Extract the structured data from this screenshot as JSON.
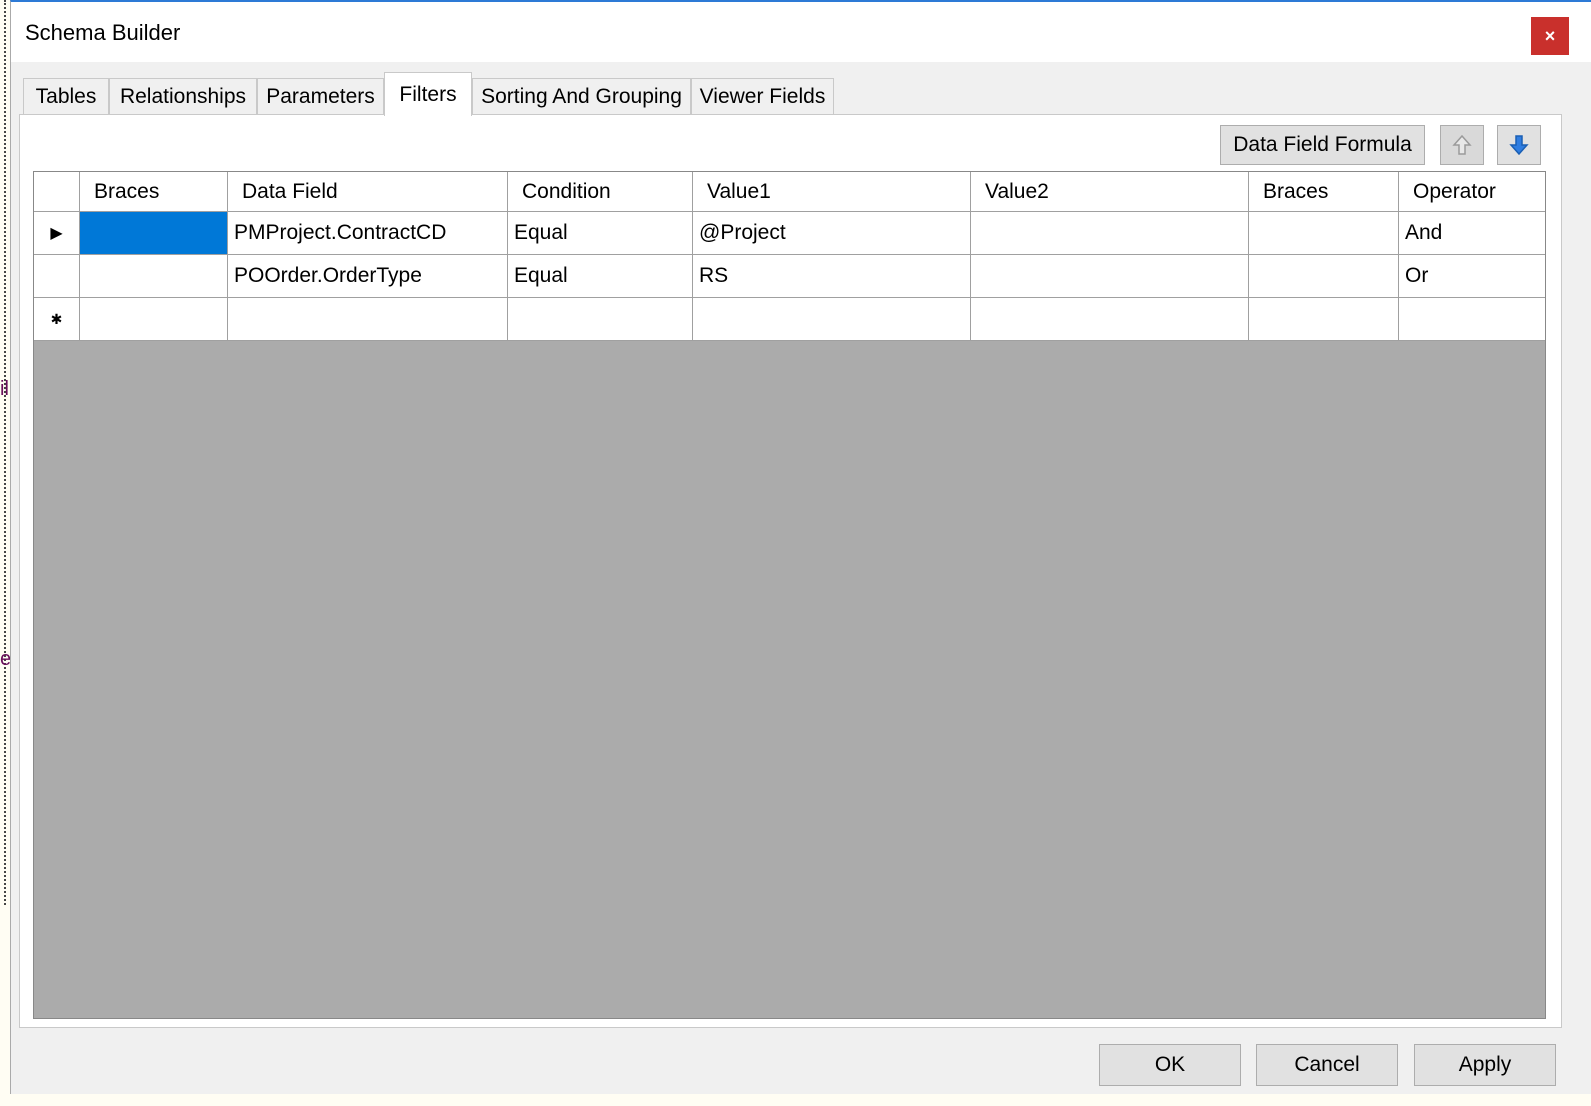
{
  "window": {
    "title": "Schema Builder",
    "close_label": "×"
  },
  "background": {
    "fragment_1": "il",
    "fragment_2": "el"
  },
  "tabs": [
    {
      "label": "Tables",
      "active": false
    },
    {
      "label": "Relationships",
      "active": false
    },
    {
      "label": "Parameters",
      "active": false
    },
    {
      "label": "Filters",
      "active": true
    },
    {
      "label": "Sorting And Grouping",
      "active": false
    },
    {
      "label": "Viewer Fields",
      "active": false
    }
  ],
  "toolbar": {
    "formula_label": "Data Field Formula",
    "move_up_icon": "arrow-up-icon",
    "move_down_icon": "arrow-down-icon"
  },
  "grid": {
    "columns": [
      "Braces",
      "Data Field",
      "Condition",
      "Value1",
      "Value2",
      "Braces",
      "Operator"
    ],
    "rows": [
      {
        "marker": "▶",
        "cells": [
          "",
          "PMProject.ContractCD",
          "Equal",
          "@Project",
          "",
          "",
          "And"
        ]
      },
      {
        "marker": "",
        "cells": [
          "",
          "POOrder.OrderType",
          "Equal",
          "RS",
          "",
          "",
          "Or"
        ]
      }
    ],
    "new_row_marker": "✱"
  },
  "footer": {
    "ok_label": "OK",
    "cancel_label": "Cancel",
    "apply_label": "Apply"
  },
  "colors": {
    "selection": "#0078d7",
    "grid_empty": "#ababab",
    "close": "#c9302c",
    "accent": "#2d7ad6"
  }
}
